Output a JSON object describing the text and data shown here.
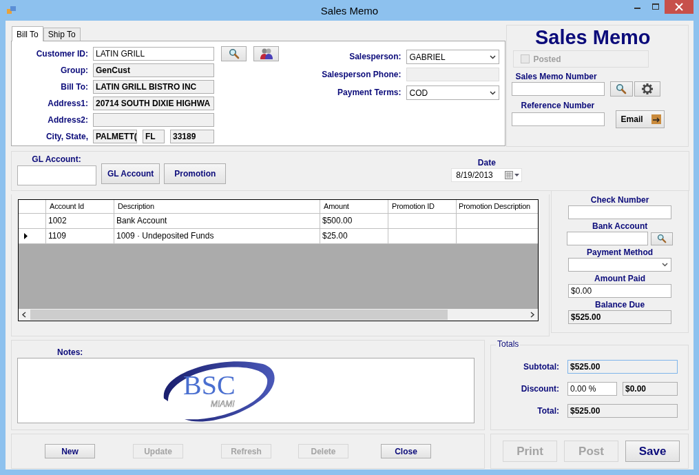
{
  "window": {
    "title": "Sales Memo"
  },
  "tabs": [
    {
      "label": "Bill To",
      "selected": true
    },
    {
      "label": "Ship To",
      "selected": false
    }
  ],
  "customer_fields": [
    {
      "label": "Customer ID:",
      "kind": "input",
      "value": "LATIN GRILL"
    },
    {
      "label": "Group:",
      "kind": "readonly",
      "value": "GenCust"
    },
    {
      "label": "Bill To:",
      "kind": "readonly",
      "value": "LATIN GRILL BISTRO INC"
    },
    {
      "label": "Address1:",
      "kind": "readonly",
      "value": "20714 SOUTH DIXIE HIGHWA"
    },
    {
      "label": "Address2:",
      "kind": "readonly"
    },
    {
      "label": "City, State,",
      "kind": "city",
      "values": [
        "PALMETT(",
        "FL",
        "33189"
      ]
    }
  ],
  "sales_fields": [
    {
      "label": "Salesperson:",
      "kind": "select",
      "value": "GABRIEL"
    },
    {
      "label": "Salesperson Phone:",
      "kind": "readonly"
    },
    {
      "label": "Payment Terms:",
      "kind": "select",
      "value": "COD"
    }
  ],
  "header": {
    "title": "Sales Memo",
    "posted": {
      "label": "Posted",
      "checked": false,
      "disabled": true
    },
    "memo_number_label": "Sales Memo Number",
    "reference_label": "Reference Number",
    "email_button": "Email"
  },
  "gl": {
    "label": "GL Account:",
    "buttons": [
      "GL Account",
      "Promotion"
    ]
  },
  "date": {
    "label": "Date",
    "value": "8/19/2013"
  },
  "table": {
    "columns": [
      "Account Id",
      "Description",
      "Amount",
      "Promotion ID",
      "Promotion Description"
    ],
    "rows": [
      {
        "selected": false,
        "cells": [
          "1002",
          "Bank Account",
          "$500.00",
          "",
          ""
        ]
      },
      {
        "selected": true,
        "cells": [
          "1109",
          "1009 · Undeposited Funds",
          "$25.00",
          "",
          ""
        ]
      }
    ]
  },
  "payment": [
    {
      "label": "Check Number",
      "kind": "input"
    },
    {
      "label": "Bank Account",
      "kind": "lookup"
    },
    {
      "label": "Payment Method",
      "kind": "select"
    },
    {
      "label": "Amount Paid",
      "kind": "input",
      "value": "$0.00"
    },
    {
      "label": "Balance Due",
      "kind": "readonly",
      "value": "$525.00"
    }
  ],
  "notes": {
    "label": "Notes:",
    "logo": {
      "text": "BSC",
      "subtext": "MIAMI"
    }
  },
  "totals": {
    "title": "Totals",
    "subtotal_label": "Subtotal:",
    "subtotal": "$525.00",
    "discount_label": "Discount:",
    "discount_percent": "0.00 %",
    "discount_amount": "$0.00",
    "total_label": "Total:",
    "total": "$525.00"
  },
  "buttons": [
    {
      "label": "New",
      "disabled": false
    },
    {
      "label": "Update",
      "disabled": true
    },
    {
      "label": "Refresh",
      "disabled": true
    },
    {
      "label": "Delete",
      "disabled": true
    },
    {
      "label": "Close",
      "disabled": false
    }
  ],
  "action_buttons": [
    {
      "label": "Print",
      "disabled": true
    },
    {
      "label": "Post",
      "disabled": true
    },
    {
      "label": "Save",
      "disabled": false
    }
  ]
}
